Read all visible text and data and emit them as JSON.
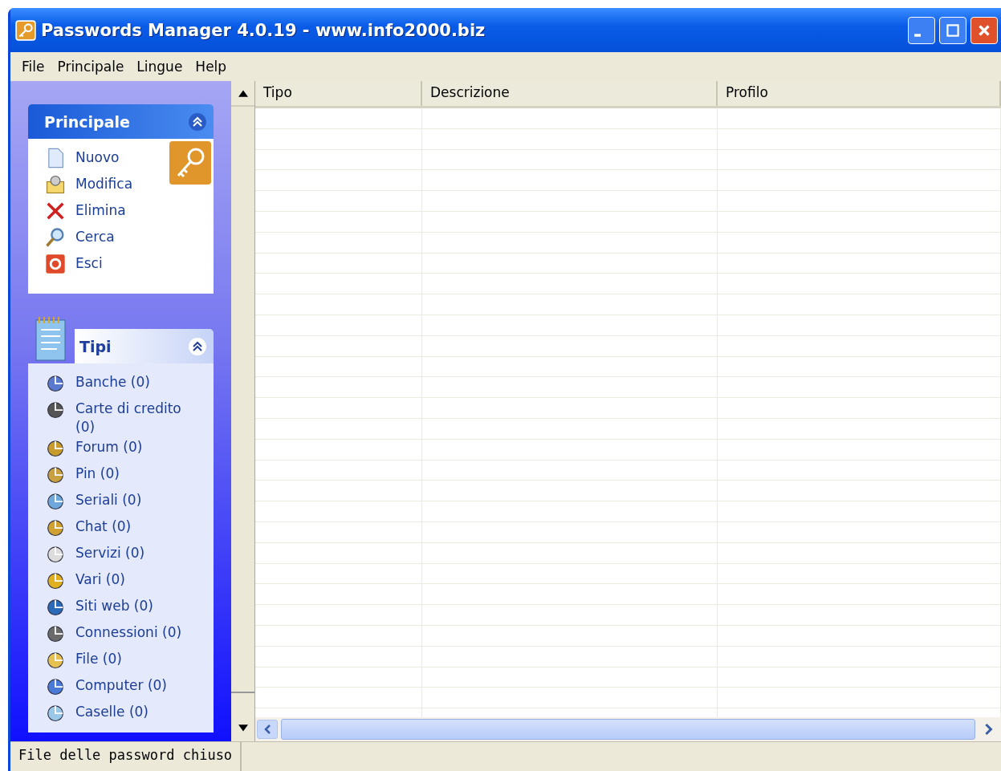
{
  "window": {
    "title": "Passwords Manager 4.0.19 - www.info2000.biz"
  },
  "menu": [
    "File",
    "Principale",
    "Lingue",
    "Help"
  ],
  "panels": [
    {
      "title": "Principale",
      "kind": "actions",
      "items": [
        {
          "label": "Nuovo"
        },
        {
          "label": "Modifica"
        },
        {
          "label": "Elimina"
        },
        {
          "label": "Cerca"
        },
        {
          "label": "Esci"
        }
      ]
    },
    {
      "title": "Tipi",
      "kind": "types",
      "items": [
        {
          "label": "Banche (0)"
        },
        {
          "label": "Carte di credito (0)"
        },
        {
          "label": "Forum (0)"
        },
        {
          "label": "Pin (0)"
        },
        {
          "label": "Seriali (0)"
        },
        {
          "label": "Chat (0)"
        },
        {
          "label": "Servizi (0)"
        },
        {
          "label": "Vari (0)"
        },
        {
          "label": "Siti web (0)"
        },
        {
          "label": "Connessioni (0)"
        },
        {
          "label": "File (0)"
        },
        {
          "label": "Computer (0)"
        },
        {
          "label": "Caselle (0)"
        }
      ]
    }
  ],
  "table": {
    "columns": [
      "Tipo",
      "Descrizione",
      "Profilo"
    ]
  },
  "status_bar": "File delle password chiuso"
}
